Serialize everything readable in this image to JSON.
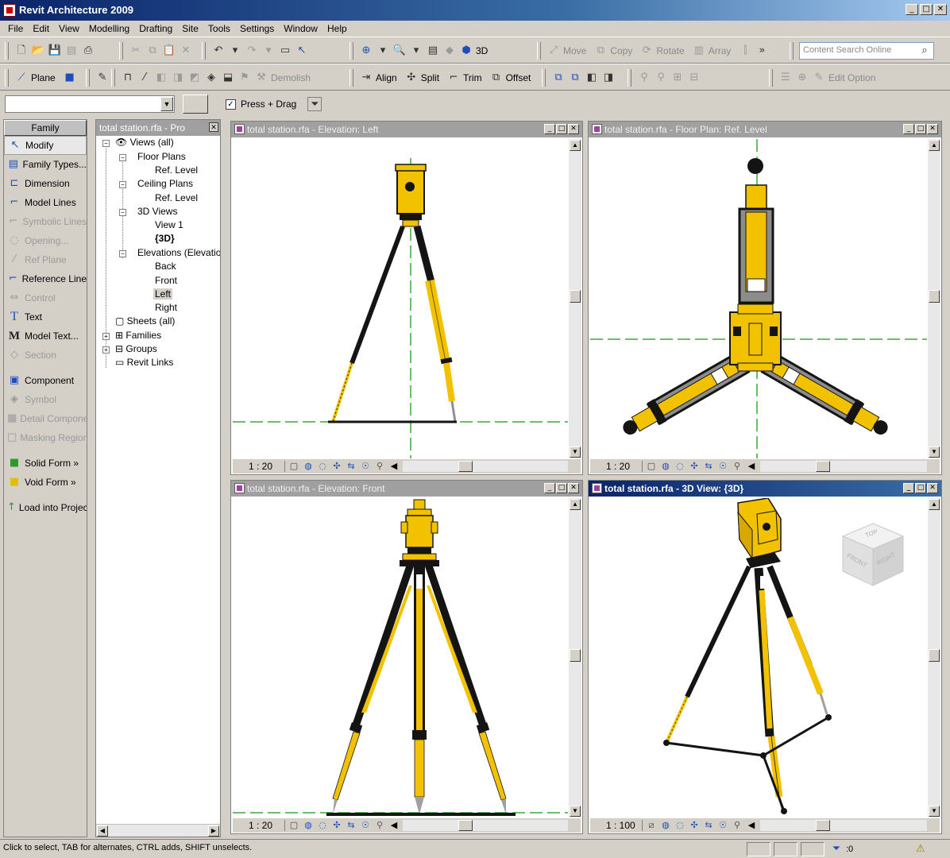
{
  "window": {
    "title": "Revit Architecture 2009",
    "min": "_",
    "max": "□",
    "close": "✕"
  },
  "menu": [
    "File",
    "Edit",
    "View",
    "Modelling",
    "Drafting",
    "Site",
    "Tools",
    "Settings",
    "Window",
    "Help"
  ],
  "toolbar1": {
    "view_3d_label": "3D",
    "move_label": "Move",
    "copy_label": "Copy",
    "rotate_label": "Rotate",
    "array_label": "Array",
    "search_placeholder": "Content Search Online"
  },
  "toolbar2": {
    "plane_label": "Plane",
    "demolish_label": "Demolish",
    "align_label": "Align",
    "split_label": "Split",
    "trim_label": "Trim",
    "offset_label": "Offset",
    "edit_option_label": "Edit Option"
  },
  "options": {
    "press_drag_label": "Press + Drag",
    "press_drag_checked": "✓"
  },
  "design_bar": {
    "tab": "Family",
    "items": [
      {
        "label": "Modify",
        "icon": "↖",
        "enabled": true
      },
      {
        "label": "Family Types...",
        "icon": "▤",
        "enabled": true
      },
      {
        "label": "Dimension",
        "icon": "⊏",
        "enabled": true
      },
      {
        "label": "Model Lines",
        "icon": "⌐",
        "enabled": true
      },
      {
        "label": "Symbolic Lines",
        "icon": "⌐",
        "enabled": false
      },
      {
        "label": "Opening...",
        "icon": "◌",
        "enabled": false
      },
      {
        "label": "Ref Plane",
        "icon": "⁄",
        "enabled": false
      },
      {
        "label": "Reference Line",
        "icon": "⌐",
        "enabled": true
      },
      {
        "label": "Control",
        "icon": "⇔",
        "enabled": false
      },
      {
        "label": "Text",
        "icon": "T",
        "enabled": true
      },
      {
        "label": "Model Text...",
        "icon": "M",
        "enabled": true
      },
      {
        "label": "Section",
        "icon": "◇",
        "enabled": false
      },
      {
        "label": "Component",
        "icon": "▣",
        "enabled": true
      },
      {
        "label": "Symbol",
        "icon": "◈",
        "enabled": false
      },
      {
        "label": "Detail Component",
        "icon": "▦",
        "enabled": false
      },
      {
        "label": "Masking Region",
        "icon": "□",
        "enabled": false
      },
      {
        "label": "Solid Form »",
        "icon": "■",
        "enabled": true
      },
      {
        "label": "Void Form »",
        "icon": "■",
        "enabled": true
      },
      {
        "label": "Load into Project",
        "icon": "↑",
        "enabled": true
      }
    ]
  },
  "browser": {
    "title": "total station.rfa - Pro",
    "nodes": {
      "views_all": "Views (all)",
      "floor_plans": "Floor Plans",
      "fp_ref_level": "Ref. Level",
      "ceiling_plans": "Ceiling Plans",
      "cp_ref_level": "Ref. Level",
      "views_3d": "3D Views",
      "view1": "View 1",
      "view_3d": "{3D}",
      "elevations": "Elevations (Elevation",
      "back": "Back",
      "front": "Front",
      "left": "Left",
      "right": "Right",
      "sheets": "Sheets (all)",
      "families": "Families",
      "groups": "Groups",
      "revit_links": "Revit Links"
    }
  },
  "views": [
    {
      "title": "total station.rfa - Elevation: Left",
      "scale": "1 : 20"
    },
    {
      "title": "total station.rfa - Floor Plan: Ref. Level",
      "scale": "1 : 20"
    },
    {
      "title": "total station.rfa - Elevation: Front",
      "scale": "1 : 20"
    },
    {
      "title": "total station.rfa - 3D View: {3D}",
      "scale": "1 : 100"
    }
  ],
  "viewcube": {
    "top": "TOP",
    "front": "FRONT",
    "right": "RIGHT"
  },
  "status": {
    "message": "Click to select, TAB for alternates, CTRL adds, SHIFT unselects.",
    "filter_count": ":0"
  },
  "colors": {
    "yellow": "#f2c200",
    "black": "#141414",
    "green_dash": "#3aaa3a",
    "gray_body": "#8c8c8c"
  }
}
